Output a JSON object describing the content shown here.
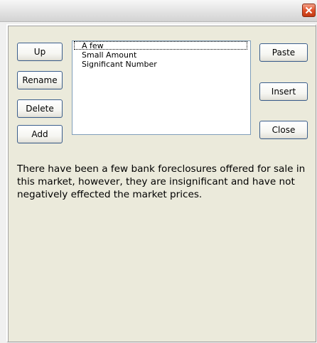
{
  "window": {
    "close_icon": "close-icon",
    "accent_color": "#d8461c"
  },
  "buttons": {
    "up": "Up",
    "rename": "Rename",
    "delete": "Delete",
    "add": "Add",
    "paste": "Paste",
    "insert": "Insert",
    "close": "Close"
  },
  "list": {
    "items": [
      "A few",
      "Small Amount",
      "Significant Number"
    ],
    "selected": "A few"
  },
  "description": "There have been a few bank foreclosures offered for sale in this market, however, they are insignificant and have not negatively effected the market prices."
}
